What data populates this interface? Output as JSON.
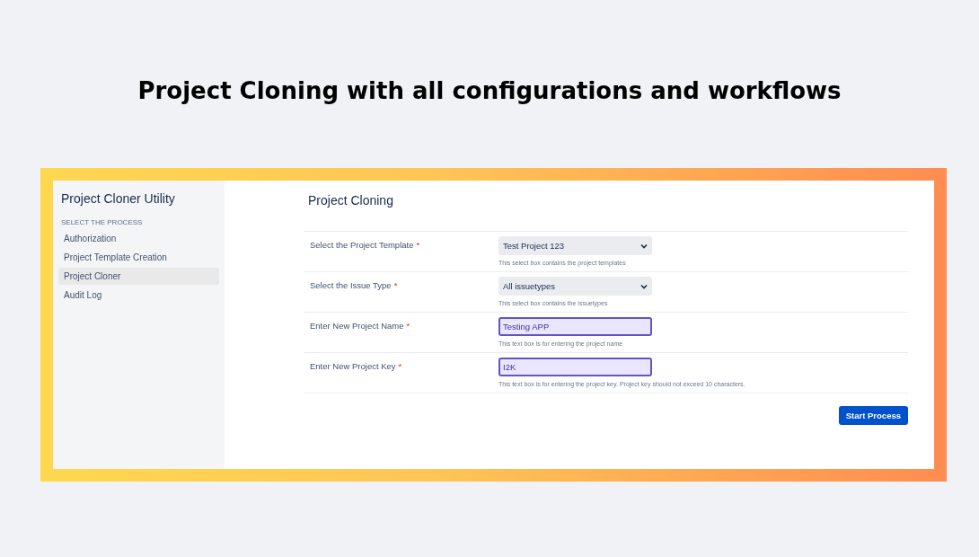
{
  "headline": "Project Cloning with all configurations and workflows",
  "sidebar": {
    "title": "Project Cloner Utility",
    "section": "SELECT THE PROCESS",
    "items": [
      {
        "label": "Authorization",
        "selected": false
      },
      {
        "label": "Project Template Creation",
        "selected": false
      },
      {
        "label": "Project Cloner",
        "selected": true
      },
      {
        "label": "Audit Log",
        "selected": false
      }
    ]
  },
  "form": {
    "title": "Project Cloning",
    "fields": [
      {
        "kind": "select",
        "label": "Select the Project Template",
        "required_mark": "*",
        "value": "Test Project 123",
        "help": "This select box contains the project templates"
      },
      {
        "kind": "select",
        "label": "Select the Issue Type",
        "required_mark": "*",
        "value": "All issuetypes",
        "help": "This select box contains the issuetypes"
      },
      {
        "kind": "text",
        "label": "Enter New Project Name",
        "required_mark": "*",
        "value": "Testing APP",
        "help": "This text box is for entering the project name"
      },
      {
        "kind": "text",
        "label": "Enter New Project Key",
        "required_mark": "*",
        "value": "I2K",
        "help": "This text box is for entering the project key. Project key should not exceed 10 characters."
      }
    ],
    "submit": "Start Process"
  }
}
